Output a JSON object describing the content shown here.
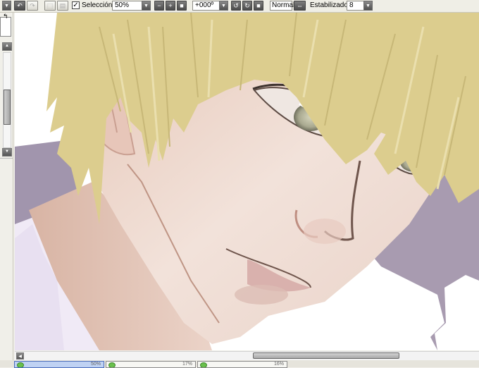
{
  "toolbar": {
    "undo_icon": "undo-icon",
    "redo_icon": "redo-icon",
    "selection_label": "Selección",
    "selection_checked": true,
    "zoom_value": "50%",
    "rotation_value": "+000º",
    "blend_mode": "Normal",
    "stabilizer_label": "Estabilizador",
    "stabilizer_value": "8"
  },
  "layers": [
    {
      "name": "",
      "opacity": "50%",
      "active": true
    },
    {
      "name": "",
      "opacity": "17%",
      "active": false
    },
    {
      "name": "",
      "opacity": "16%",
      "active": false
    }
  ],
  "colors": {
    "hair": "#dccd8e",
    "skin": "#f0dfd6",
    "background_shadow": "#a89bb0",
    "toolbar": "#efeee6",
    "active_layer": "#bfd2f3"
  }
}
